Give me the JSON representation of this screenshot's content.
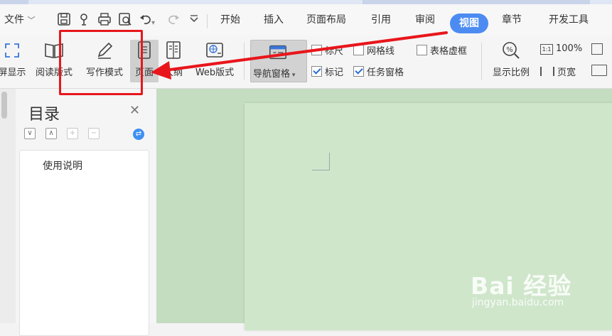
{
  "menubar": {
    "file_label": "文件",
    "tabs": [
      {
        "label": "开始"
      },
      {
        "label": "插入"
      },
      {
        "label": "页面布局"
      },
      {
        "label": "引用"
      },
      {
        "label": "审阅"
      },
      {
        "label": "视图",
        "active": true
      },
      {
        "label": "章节"
      },
      {
        "label": "开发工具"
      }
    ]
  },
  "ribbon": {
    "buttons": [
      {
        "label": "屏显示",
        "icon": "fullscreen-icon"
      },
      {
        "label": "阅读版式",
        "icon": "book-icon"
      },
      {
        "label": "写作模式",
        "icon": "pencil-icon"
      },
      {
        "label": "页面",
        "icon": "page-icon",
        "pressed": true
      },
      {
        "label": "大纲",
        "icon": "outline-icon"
      },
      {
        "label": "Web版式",
        "icon": "globe-icon"
      }
    ],
    "nav_pane": {
      "label": "导航窗格",
      "icon": "nav-pane-icon"
    },
    "checkboxes": [
      {
        "label": "标尺",
        "checked": false
      },
      {
        "label": "网格线",
        "checked": false
      },
      {
        "label": "表格虚框",
        "checked": false
      },
      {
        "label": "标记",
        "checked": true
      },
      {
        "label": "任务窗格",
        "checked": true
      }
    ],
    "zoom": {
      "label": "显示比例",
      "value": "100%",
      "page_width_label": "页宽",
      "icon": "zoom-icon"
    }
  },
  "toc": {
    "title": "目录",
    "items": [
      {
        "label": "使用说明"
      }
    ]
  },
  "watermark": {
    "logo_text": "Bai 经验",
    "url": "jingyan.baidu.com"
  },
  "colors": {
    "accent": "#4c8cf2",
    "highlight_red": "#e8161b",
    "canvas_green": "#c4dcc0"
  }
}
